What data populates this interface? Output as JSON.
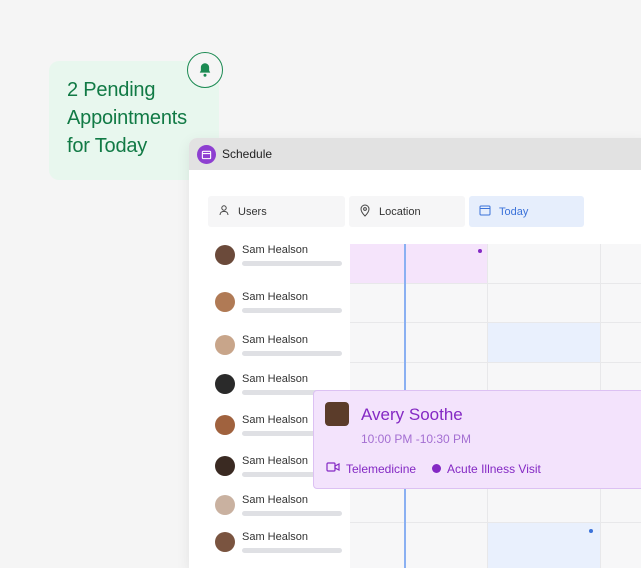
{
  "notification": {
    "text": "2 Pending Appointments for Today",
    "icon": "bell-icon"
  },
  "window": {
    "title": "Schedule"
  },
  "filters": {
    "users": "Users",
    "location": "Location",
    "today": "Today"
  },
  "users": [
    {
      "name": "Sam Healson"
    },
    {
      "name": "Sam Healson"
    },
    {
      "name": "Sam Healson"
    },
    {
      "name": "Sam Healson"
    },
    {
      "name": "Sam Healson"
    },
    {
      "name": "Sam Healson"
    },
    {
      "name": "Sam Healson"
    },
    {
      "name": "Sam Healson"
    }
  ],
  "event": {
    "name": "Avery Soothe",
    "time": "10:00 PM -10:30 PM",
    "type": "Telemedicine",
    "reason": "Acute Illness Visit"
  },
  "colors": {
    "accent": "#8429c4",
    "notification_green": "#117a45",
    "today_blue": "#3b72d9"
  }
}
